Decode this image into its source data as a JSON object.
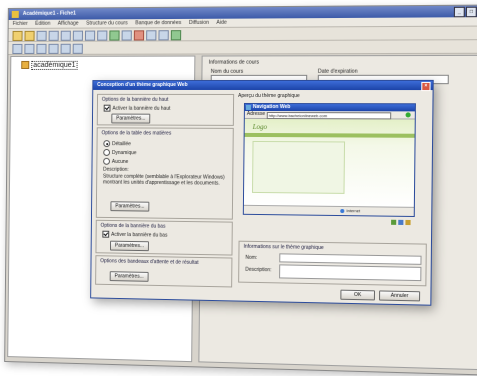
{
  "app": {
    "title": "Académique1 - Fiche1",
    "menu": [
      "Fichier",
      "Édition",
      "Affichage",
      "Structure du cours",
      "Banque de données",
      "Diffusion",
      "Aide"
    ],
    "tree_root": "académique1"
  },
  "right_pane": {
    "title": "Informations de cours",
    "label_course_name": "Nom du cours",
    "label_date": "Date d'expiration"
  },
  "dialog": {
    "title": "Conception d'un thème graphique Web",
    "top_banner": {
      "title": "Options de la bannière du haut",
      "checkbox_label": "Activer la bannière du haut",
      "button": "Paramètres..."
    },
    "toc": {
      "title": "Options de la table des matières",
      "options": [
        "Détaillée",
        "Dynamique",
        "Aucune"
      ],
      "selected": "Détaillée",
      "description_label": "Description:",
      "description": "Structure complète (semblable à l'Explorateur Windows) montrant les unités d'apprentissage et les documents.",
      "button": "Paramètres..."
    },
    "bottom_banner": {
      "title": "Options de la bannière du bas",
      "checkbox_label": "Activer la bannière du bas",
      "button": "Paramètres..."
    },
    "result_banner": {
      "title": "Options des bandeaux d'attente et de résultat",
      "button": "Paramètres..."
    },
    "preview": {
      "title": "Aperçu du thème graphique",
      "browser_title": "Navigation Web",
      "address_label": "Adresse",
      "address": "http://www.bacheionlineweb.com",
      "logo": "Logo",
      "status": "Internet"
    },
    "info": {
      "title": "Informations sur le thème graphique",
      "name_label": "Nom:",
      "description_label": "Description:"
    },
    "ok": "OK",
    "cancel": "Annuler"
  }
}
